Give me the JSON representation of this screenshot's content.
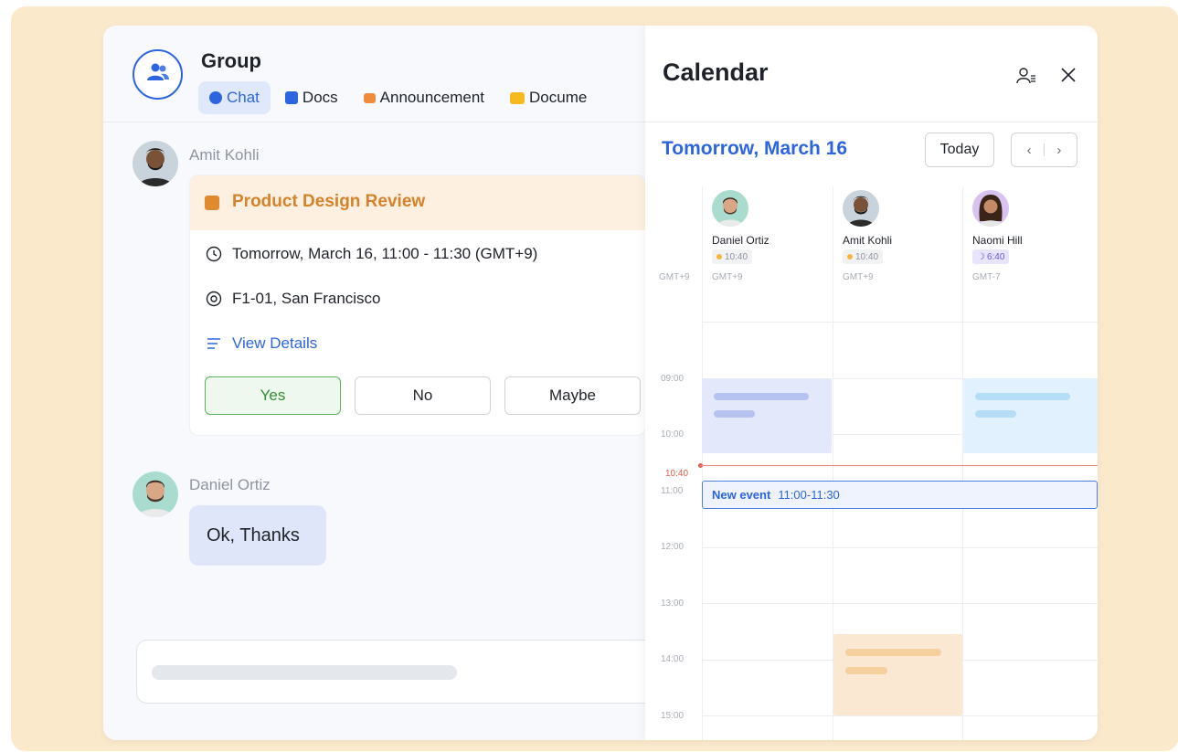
{
  "group": {
    "title": "Group",
    "tabs": [
      {
        "label": "Chat",
        "active": true,
        "icon": "chat-icon"
      },
      {
        "label": "Docs",
        "icon": "docs-icon"
      },
      {
        "label": "Announcement",
        "icon": "megaphone-icon"
      },
      {
        "label": "Docume",
        "icon": "folder-icon"
      }
    ]
  },
  "messages": [
    {
      "sender": "Amit Kohli",
      "event_card": {
        "title": "Product Design Review",
        "time": "Tomorrow, March 16, 11:00 - 11:30 (GMT+9)",
        "location": "F1-01, San Francisco",
        "details_label": "View Details",
        "rsvp": {
          "yes": "Yes",
          "no": "No",
          "maybe": "Maybe"
        }
      }
    },
    {
      "sender": "Daniel Ortiz",
      "text": "Ok, Thanks"
    }
  ],
  "calendar": {
    "title": "Calendar",
    "date_label": "Tomorrow, March 16",
    "today_label": "Today",
    "prev_label": "‹",
    "next_label": "›",
    "own_timezone": "GMT+9",
    "people": [
      {
        "name": "Daniel Ortiz",
        "local_time": "10:40",
        "timezone": "GMT+9",
        "night": false
      },
      {
        "name": "Amit Kohli",
        "local_time": "10:40",
        "timezone": "GMT+9",
        "night": false
      },
      {
        "name": "Naomi Hill",
        "local_time": "6:40",
        "timezone": "GMT-7",
        "night": true
      }
    ],
    "hours": [
      "09:00",
      "10:00",
      "11:00",
      "12:00",
      "13:00",
      "14:00",
      "15:00"
    ],
    "current_time": "10:40",
    "new_event": {
      "title": "New event",
      "time": "11:00-11:30"
    }
  },
  "colors": {
    "accent": "#2d65e0",
    "event_header": "#d5822a",
    "busy_purple": "#e3e8fb",
    "busy_blue": "#e1f1fd",
    "busy_orange": "#fbe8d2",
    "now_line": "#e55b4a"
  }
}
